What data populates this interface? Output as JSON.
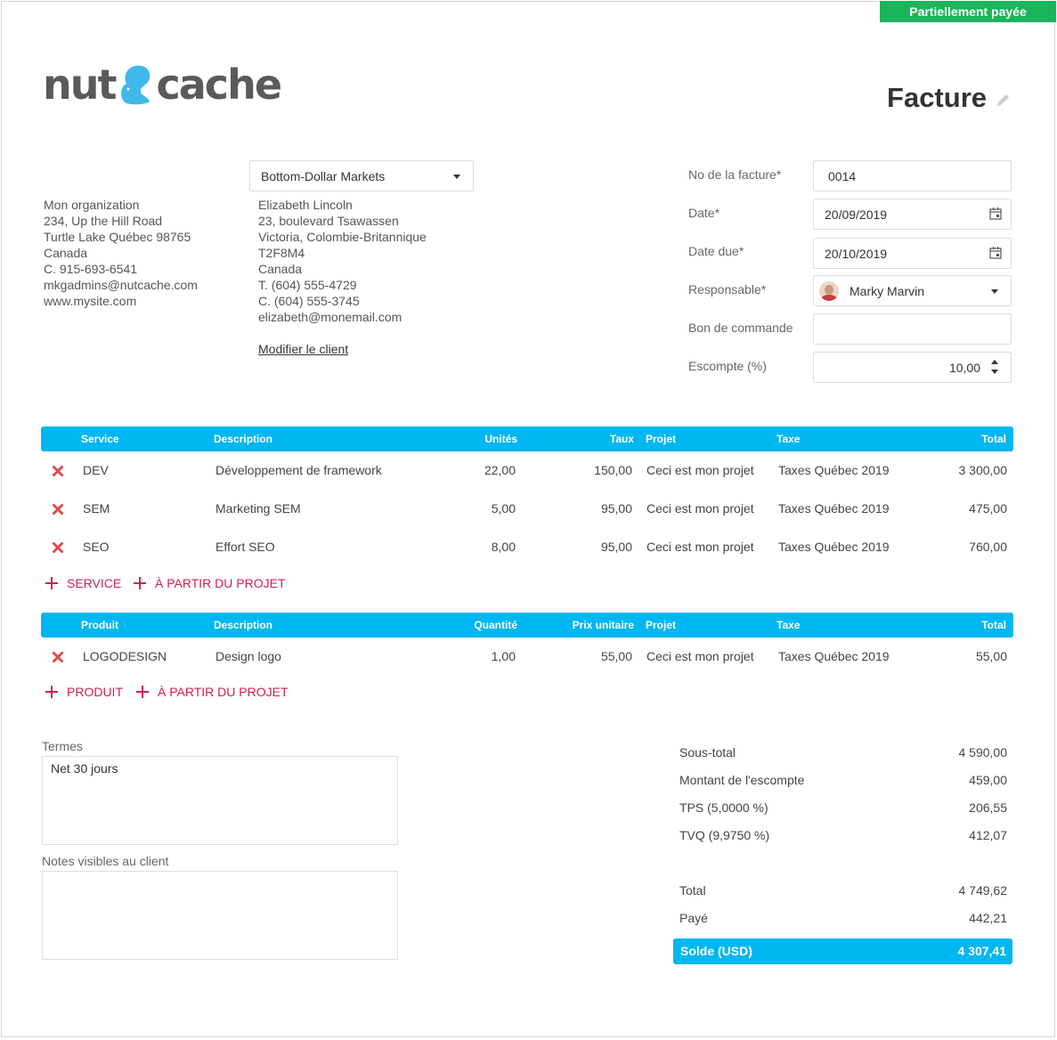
{
  "status_badge": "Partiellement payée",
  "logo": {
    "left": "nut",
    "right": "cache"
  },
  "doc_title": "Facture",
  "org": {
    "lines": [
      "Mon organization",
      "234, Up the Hill Road",
      "Turtle Lake Québec 98765",
      "Canada",
      "C. 915-693-6541",
      "mkgadmins@nutcache.com",
      "www.mysite.com"
    ]
  },
  "client": {
    "selected": "Bottom-Dollar Markets",
    "lines": [
      "Elizabeth Lincoln",
      "23, boulevard Tsawassen",
      "Victoria, Colombie-Britannique",
      "T2F8M4",
      "Canada",
      "T. (604) 555-4729",
      "C. (604) 555-3745",
      "elizabeth@monemail.com"
    ],
    "edit_link": "Modifier le client"
  },
  "form": {
    "invoice_no_label": "No de la facture*",
    "invoice_no": "0014",
    "date_label": "Date*",
    "date": "20/09/2019",
    "due_label": "Date due*",
    "due": "20/10/2019",
    "owner_label": "Responsable*",
    "owner": "Marky Marvin",
    "po_label": "Bon de commande",
    "po": "",
    "discount_label": "Escompte (%)",
    "discount": "10,00"
  },
  "services": {
    "headers": [
      "Service",
      "Description",
      "Unités",
      "Taux",
      "Projet",
      "Taxe",
      "Total"
    ],
    "rows": [
      [
        "DEV",
        "Développement de framework",
        "22,00",
        "150,00",
        "Ceci est mon projet",
        "Taxes Québec 2019",
        "3 300,00"
      ],
      [
        "SEM",
        "Marketing SEM",
        "5,00",
        "95,00",
        "Ceci est mon projet",
        "Taxes Québec 2019",
        "475,00"
      ],
      [
        "SEO",
        "Effort SEO",
        "8,00",
        "95,00",
        "Ceci est mon projet",
        "Taxes Québec 2019",
        "760,00"
      ]
    ],
    "add_label": "SERVICE",
    "from_project_label": "À PARTIR DU PROJET"
  },
  "products": {
    "headers": [
      "Produit",
      "Description",
      "Quantité",
      "Prix unitaire",
      "Projet",
      "Taxe",
      "Total"
    ],
    "rows": [
      [
        "LOGODESIGN",
        "Design logo",
        "1,00",
        "55,00",
        "Ceci est mon projet",
        "Taxes Québec 2019",
        "55,00"
      ]
    ],
    "add_label": "PRODUIT",
    "from_project_label": "À PARTIR DU PROJET"
  },
  "terms": {
    "label": "Termes",
    "value": "Net 30 jours"
  },
  "notes": {
    "label": "Notes visibles au client",
    "value": ""
  },
  "summary": {
    "subtotal_label": "Sous-total",
    "subtotal": "4 590,00",
    "discount_label": "Montant de l'escompte",
    "discount": "459,00",
    "tps_label": "TPS (5,0000 %)",
    "tps": "206,55",
    "tvq_label": "TVQ (9,9750 %)",
    "tvq": "412,07",
    "total_label": "Total",
    "total": "4 749,62",
    "paid_label": "Payé",
    "paid": "442,21",
    "balance_label": "Solde (USD)",
    "balance": "4 307,41"
  },
  "colors": {
    "accent": "#00b7f1",
    "badge": "#1cb45a",
    "link": "#d11f4f",
    "delete": "#e04a4a"
  }
}
